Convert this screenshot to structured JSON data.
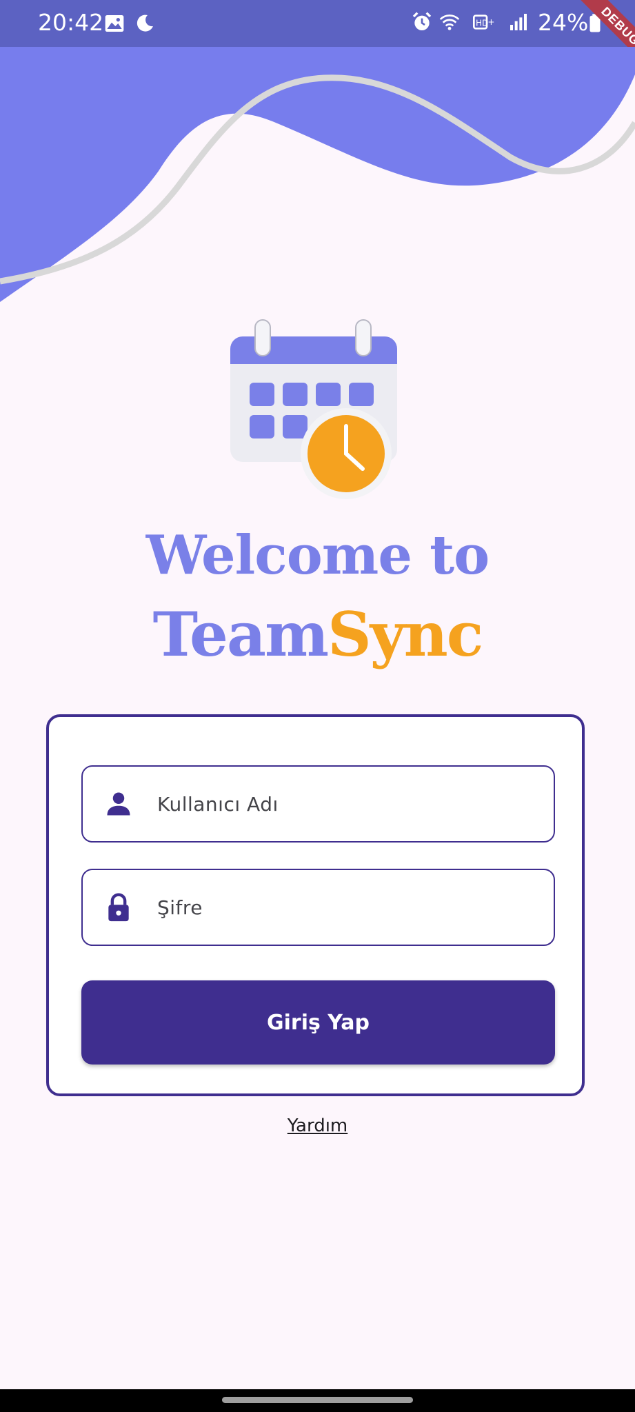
{
  "status_bar": {
    "time": "20:42",
    "battery": "24%",
    "left_icons": [
      "image-icon",
      "moon-icon"
    ],
    "right_icons": [
      "alarm-icon",
      "wifi-icon",
      "hd-icon",
      "signal-icon",
      "battery-icon"
    ],
    "background": "#5c62c2"
  },
  "debug_banner": {
    "label": "DEBUG"
  },
  "header": {
    "wave_color": "#777ded",
    "stroke_color": "#d8d8d8"
  },
  "logo": {
    "icon": "calendar-clock-icon"
  },
  "title": {
    "line1": "Welcome to",
    "brand_part1": "Team",
    "brand_part2": "Sync",
    "primary_color": "#7a80e8",
    "accent_color": "#f5a21f"
  },
  "login": {
    "username_placeholder": "Kullanıcı Adı",
    "password_placeholder": "Şifre",
    "submit_label": "Giriş Yap",
    "help_label": "Yardım",
    "primary_color": "#3f2e8f"
  }
}
